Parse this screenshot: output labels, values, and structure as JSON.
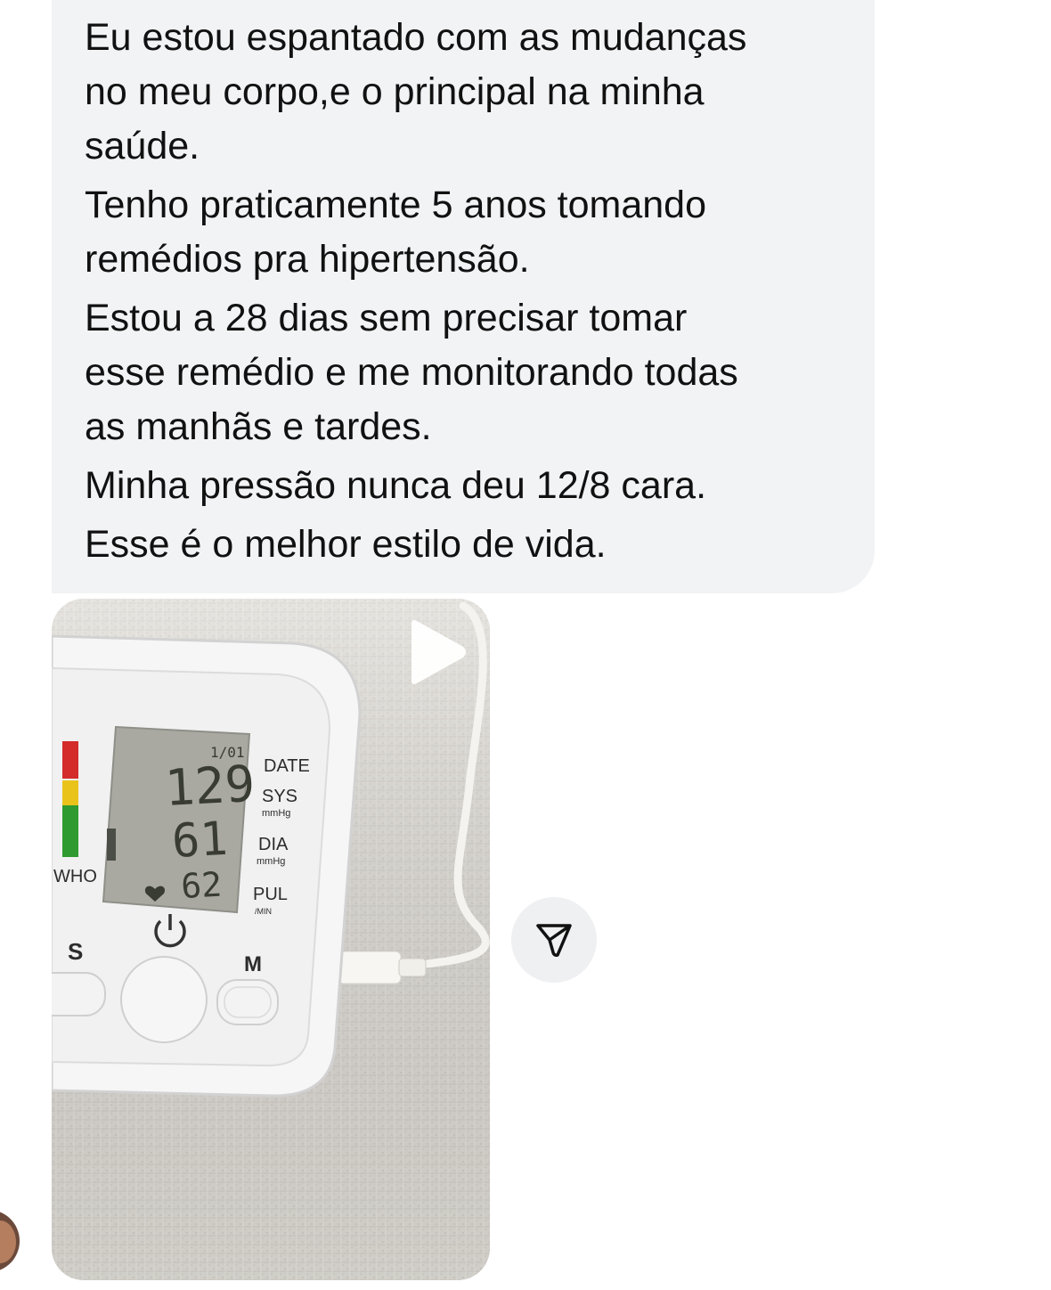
{
  "message": {
    "paragraphs": [
      [
        "Eu estou espantado com as mudanças",
        "no meu corpo,e o principal na minha",
        "saúde."
      ],
      [
        "Tenho praticamente 5 anos tomando",
        "remédios pra hipertensão."
      ],
      [
        "Estou a 28 dias sem precisar tomar",
        "esse remédio e me monitorando todas",
        "as manhãs e tardes."
      ],
      [
        "Minha pressão nunca deu 12/8 cara."
      ],
      [
        "Esse é o melhor estilo de vida."
      ]
    ]
  },
  "video": {
    "play_icon": "play-icon",
    "device": {
      "lcd_index": "1/01",
      "sys_value": "129",
      "dia_value": "61",
      "pulse_value": "62",
      "date_label": "DATE",
      "sys_label": "SYS",
      "dia_label": "DIA",
      "unit_label": "mmHg",
      "pul_label": "PUL",
      "pul_unit": "/MIN",
      "who_label": "WHO",
      "s_button": "S",
      "m_button": "M",
      "indicator_colors": [
        "#d42b2b",
        "#e9c31a",
        "#2f9a2f"
      ]
    }
  },
  "share_icon": "send-arrow-icon",
  "avatar_icon": "avatar"
}
